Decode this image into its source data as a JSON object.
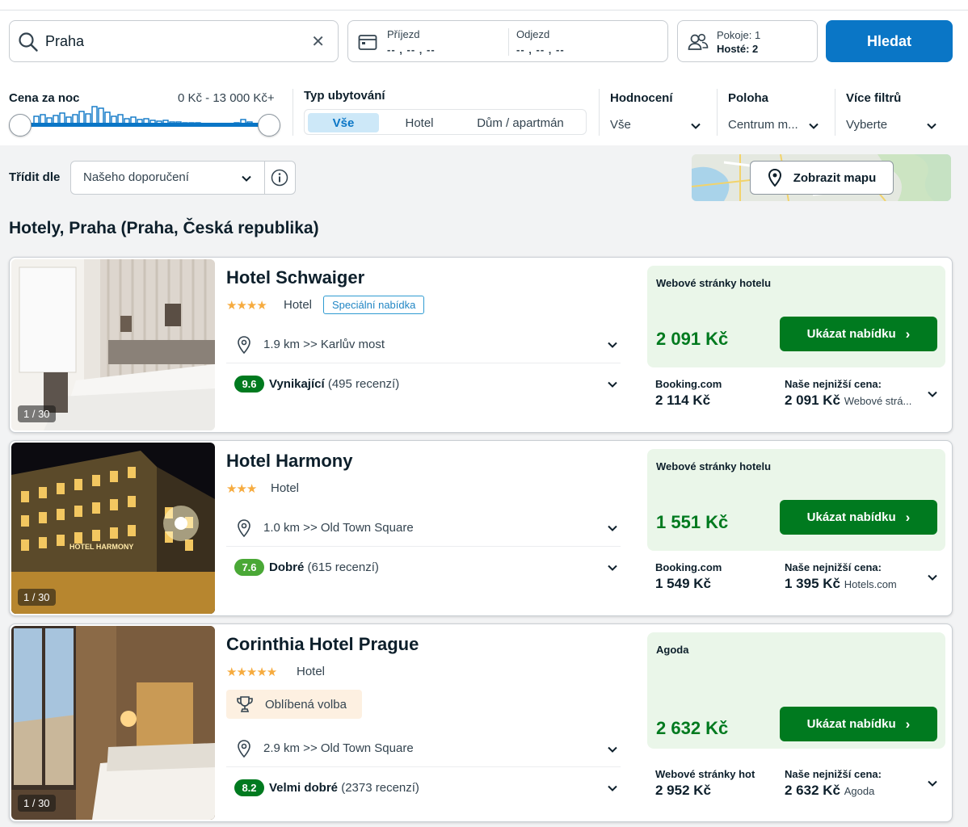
{
  "search": {
    "destination": "Praha",
    "checkin_label": "Příjezd",
    "checkin_value": "-- , -- , --",
    "checkout_label": "Odjezd",
    "checkout_value": "-- , -- , --",
    "rooms_label": "Pokoje: 1",
    "guests_label": "Hosté: 2",
    "search_button": "Hledat"
  },
  "filters": {
    "price_label": "Cena za noc",
    "price_range": "0 Kč - 13 000 Kč+",
    "type_label": "Typ ubytování",
    "type_options": [
      "Vše",
      "Hotel",
      "Dům / apartmán"
    ],
    "type_selected": "Vše",
    "rating_label": "Hodnocení",
    "rating_value": "Vše",
    "location_label": "Poloha",
    "location_value": "Centrum m...",
    "more_label": "Více filtrů",
    "more_value": "Vyberte"
  },
  "sort": {
    "label": "Třídit dle",
    "value": "Našeho doporučení",
    "map_button": "Zobrazit mapu"
  },
  "results_title": "Hotely, Praha (Praha, Česká republika)",
  "colors": {
    "primary_blue": "#0a76c6",
    "deal_green": "#007a1f",
    "rating_dark_green": "#007a1f",
    "rating_light_green": "#4aa836",
    "star_orange": "#f6ab3f"
  },
  "hotels": [
    {
      "name": "Hotel Schwaiger",
      "stars": "★★★★",
      "type": "Hotel",
      "badge": "Speciální nabídka",
      "photo_counter": "1 / 30",
      "distance": "1.9 km >> Karlův most",
      "rating_score": "9.6",
      "rating_word": "Vynikající",
      "rating_count": "(495 recenzí)",
      "offer_source": "Webové stránky hotelu",
      "offer_price": "2 091 Kč",
      "cta": "Ukázat nabídku",
      "alt_source": "Booking.com",
      "alt_price": "2 114 Kč",
      "lowest_label": "Naše nejnižší cena:",
      "lowest_price": "2 091 Kč",
      "lowest_source": "Webové strá..."
    },
    {
      "name": "Hotel Harmony",
      "stars": "★★★",
      "type": "Hotel",
      "photo_counter": "1 / 30",
      "photo_sign": "HOTEL HARMONY",
      "distance": "1.0 km >> Old Town Square",
      "rating_score": "7.6",
      "rating_word": "Dobré",
      "rating_count": "(615 recenzí)",
      "offer_source": "Webové stránky hotelu",
      "offer_price": "1 551 Kč",
      "cta": "Ukázat nabídku",
      "alt_source": "Booking.com",
      "alt_price": "1 549 Kč",
      "lowest_label": "Naše nejnižší cena:",
      "lowest_price": "1 395 Kč",
      "lowest_source": "Hotels.com"
    },
    {
      "name": "Corinthia Hotel Prague",
      "stars": "★★★★★",
      "type": "Hotel",
      "favorite": "Oblíbená volba",
      "photo_counter": "1 / 30",
      "distance": "2.9 km >> Old Town Square",
      "rating_score": "8.2",
      "rating_word": "Velmi dobré",
      "rating_count": "(2373 recenzí)",
      "offer_source": "Agoda",
      "offer_price": "2 632 Kč",
      "cta": "Ukázat nabídku",
      "alt_source": "Webové stránky hot",
      "alt_price": "2 952 Kč",
      "lowest_label": "Naše nejnižší cena:",
      "lowest_price": "2 632 Kč",
      "lowest_source": "Agoda"
    }
  ]
}
